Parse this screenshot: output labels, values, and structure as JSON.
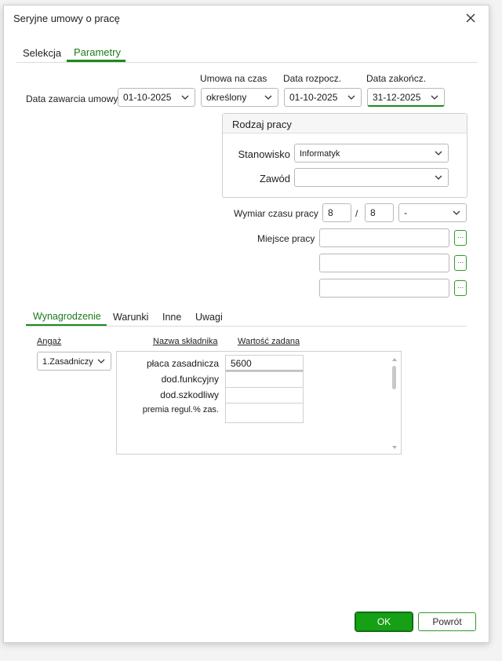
{
  "window": {
    "title": "Seryjne umowy o pracę"
  },
  "tabs": [
    {
      "label": "Selekcja",
      "active": false
    },
    {
      "label": "Parametry",
      "active": true
    }
  ],
  "contract": {
    "date_label": "Data zawarcia umowy",
    "date_value": "01-10-2025",
    "type_label": "Umowa na czas",
    "type_value": "określony",
    "start_label": "Data rozpocz.",
    "start_value": "01-10-2025",
    "end_label": "Data zakończ.",
    "end_value": "31-12-2025"
  },
  "work_type": {
    "title": "Rodzaj pracy",
    "position_label": "Stanowisko",
    "position_value": "Informatyk",
    "profession_label": "Zawód",
    "profession_value": ""
  },
  "working_time": {
    "label": "Wymiar czasu pracy",
    "numerator": "8",
    "separator": "/",
    "denominator": "8",
    "unit_value": "-"
  },
  "workplace": {
    "label": "Miejsce pracy",
    "fields": [
      "",
      "",
      ""
    ],
    "button_label": "..."
  },
  "lower_tabs": [
    {
      "label": "Wynagrodzenie",
      "active": true
    },
    {
      "label": "Warunki",
      "active": false
    },
    {
      "label": "Inne",
      "active": false
    },
    {
      "label": "Uwagi",
      "active": false
    }
  ],
  "salary": {
    "engagement_label": "Angaż",
    "engagement_value": "1.Zasadniczy",
    "col_name": "Nazwa składnika",
    "col_value": "Wartość zadana",
    "rows": [
      {
        "name": "płaca zasadnicza",
        "value": "5600"
      },
      {
        "name": "dod.funkcyjny",
        "value": ""
      },
      {
        "name": "dod.szkodliwy",
        "value": ""
      },
      {
        "name": "premia regul.% zas.",
        "value": ""
      }
    ]
  },
  "buttons": {
    "ok": "OK",
    "cancel": "Powrót"
  },
  "colors": {
    "accent": "#1c8a1c",
    "ok_bg": "#15a015"
  }
}
